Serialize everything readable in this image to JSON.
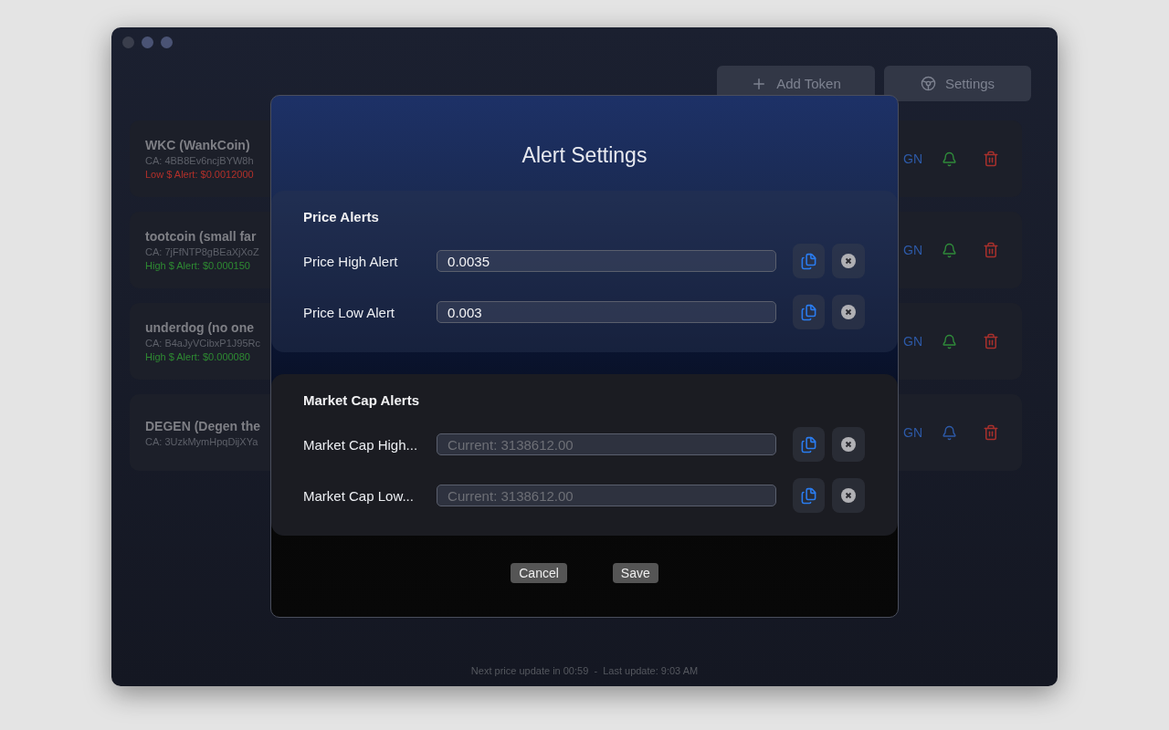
{
  "toolbar": {
    "buttons": [
      {
        "kind": "add",
        "label": "Add Token"
      },
      {
        "kind": "settings",
        "label": "Settings"
      }
    ]
  },
  "tokens": [
    {
      "name": "WKC (WankCoin)",
      "ca": "CA: 4BB8Ev6ncjBYW8h",
      "alert": {
        "kind": "low",
        "text": "Low $ Alert: $0.0012000"
      },
      "link": "GN",
      "color": "#2f8a3a"
    },
    {
      "name": "tootcoin (small far",
      "ca": "CA: 7jFfNTP8gBEaXjXoZ",
      "alert": {
        "kind": "high",
        "text": "High $ Alert: $0.000150"
      },
      "link": "GN",
      "color": "#2f8a3a"
    },
    {
      "name": "underdog (no one",
      "ca": "CA: B4aJyVCibxP1J95Rc",
      "alert": {
        "kind": "high",
        "text": "High $ Alert: $0.000080"
      },
      "link": "GN",
      "color": "#2f8a3a"
    },
    {
      "name": "DEGEN (Degen the",
      "ca": "CA: 3UzkMymHpqDijXYa",
      "link": "GN",
      "color": "#2d5aa8"
    }
  ],
  "status_bar": "Next price update in 00:59  -  Last update: 9:03 AM",
  "dialog": {
    "title": "Alert Settings",
    "sections": [
      {
        "kind": "price",
        "title": "Price Alerts",
        "rows": [
          {
            "label": "Price High Alert",
            "value": "0.0035"
          },
          {
            "label": "Price Low Alert",
            "value": "0.003"
          }
        ]
      },
      {
        "kind": "cap",
        "title": "Market Cap Alerts",
        "rows": [
          {
            "label": "Market Cap High...",
            "placeholder": "Current: 3138612.00"
          },
          {
            "label": "Market Cap Low...",
            "placeholder": "Current: 3138612.00"
          }
        ]
      }
    ],
    "buttons": [
      "Cancel",
      "Save"
    ]
  }
}
